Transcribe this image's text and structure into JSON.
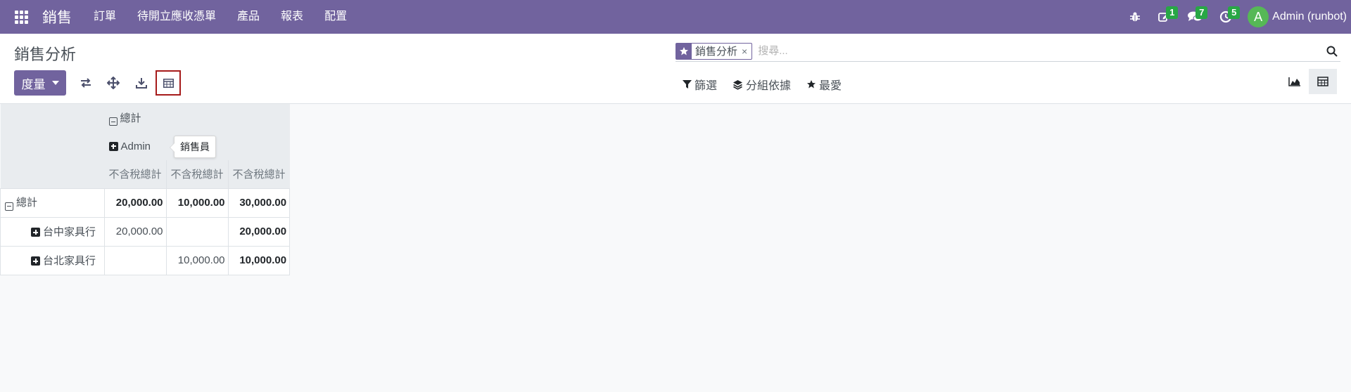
{
  "navbar": {
    "brand": "銷售",
    "menu": [
      "訂單",
      "待開立應收憑單",
      "產品",
      "報表",
      "配置"
    ],
    "badges": {
      "activity": "1",
      "messages": "7",
      "clock": "5"
    },
    "user": {
      "initial": "A",
      "name": "Admin (runbot)"
    },
    "color": "#71639e"
  },
  "control_panel": {
    "title": "銷售分析",
    "measures_label": "度量",
    "search": {
      "facet": "銷售分析",
      "facet_remove": "×",
      "placeholder": "搜尋..."
    },
    "filters": {
      "filter": "篩選",
      "group_by": "分組依據",
      "favorites": "最愛"
    }
  },
  "pivot": {
    "col_total": "總計",
    "col_group": "Admin",
    "measure": "不含稅總計",
    "tooltip": "銷售員",
    "rows": [
      {
        "label": "總計",
        "values": [
          "20,000.00",
          "10,000.00",
          "30,000.00"
        ]
      },
      {
        "label": "台中家具行",
        "values": [
          "20,000.00",
          "",
          "20,000.00"
        ]
      },
      {
        "label": "台北家具行",
        "values": [
          "",
          "10,000.00",
          "10,000.00"
        ]
      }
    ]
  }
}
